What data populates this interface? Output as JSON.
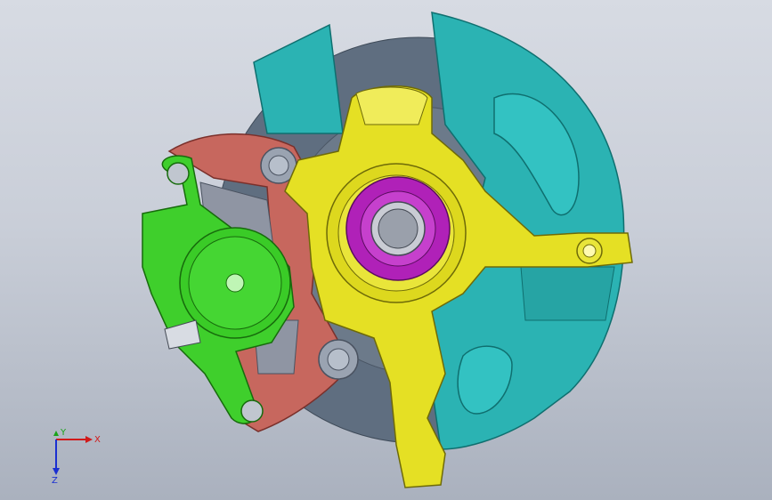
{
  "viewport": {
    "background_top": "#d7dbe3",
    "background_bottom": "#aab1be"
  },
  "parts": {
    "rotor": {
      "color": "#6c7a8a"
    },
    "dust_shield": {
      "color": "#2bb3b3"
    },
    "knuckle": {
      "color": "#e5e024"
    },
    "hub_bearing": {
      "color": "#b021b8"
    },
    "caliper_bracket": {
      "color": "#c7675e"
    },
    "caliper": {
      "color": "#3fcf2c"
    },
    "brake_pad": {
      "color": "#8f95a3"
    }
  },
  "triad": {
    "x_label": "X",
    "y_label": "Y",
    "z_label": "Z",
    "x_color": "#d11a1a",
    "y_color": "#1aa31a",
    "z_color": "#1a2fd1"
  }
}
